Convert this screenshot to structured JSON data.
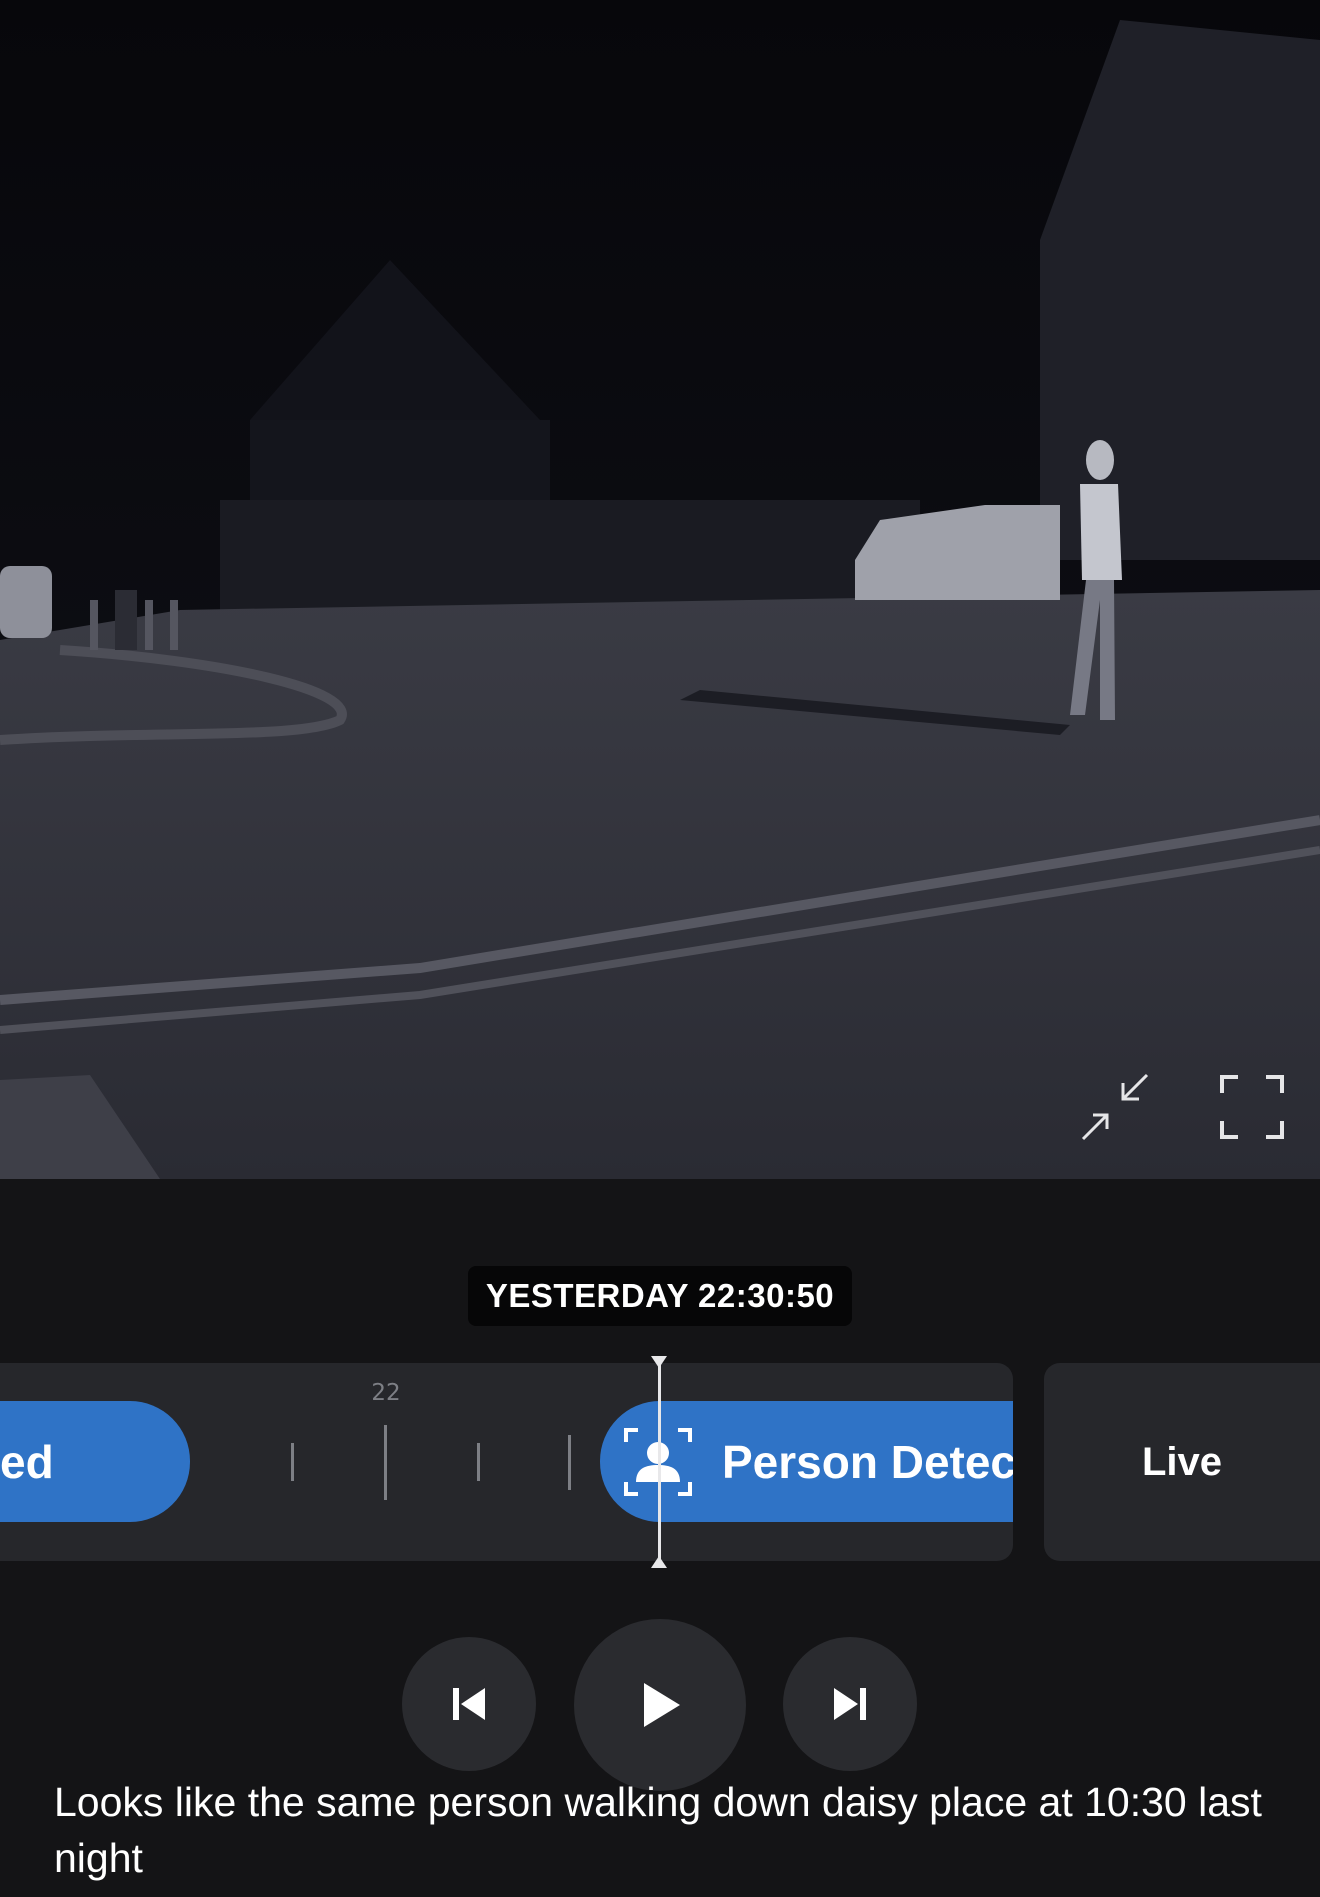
{
  "player": {
    "timestamp": "YESTERDAY 22:30:50",
    "timeline": {
      "hour_label": "22",
      "previous_event_label": "ed",
      "current_event_label": "Person Detec"
    },
    "live_label": "Live"
  },
  "icons": {
    "shrink": "exit-fullscreen-arrows-icon",
    "fullscreen": "fullscreen-corners-icon",
    "person": "person-detection-icon",
    "previous": "skip-previous-icon",
    "play": "play-icon",
    "next": "skip-next-icon"
  },
  "caption": "Looks like the same person walking down daisy place at 10:30 last night",
  "colors": {
    "event_blue": "#2f73c6",
    "background": "#141416",
    "track": "#26272b"
  }
}
